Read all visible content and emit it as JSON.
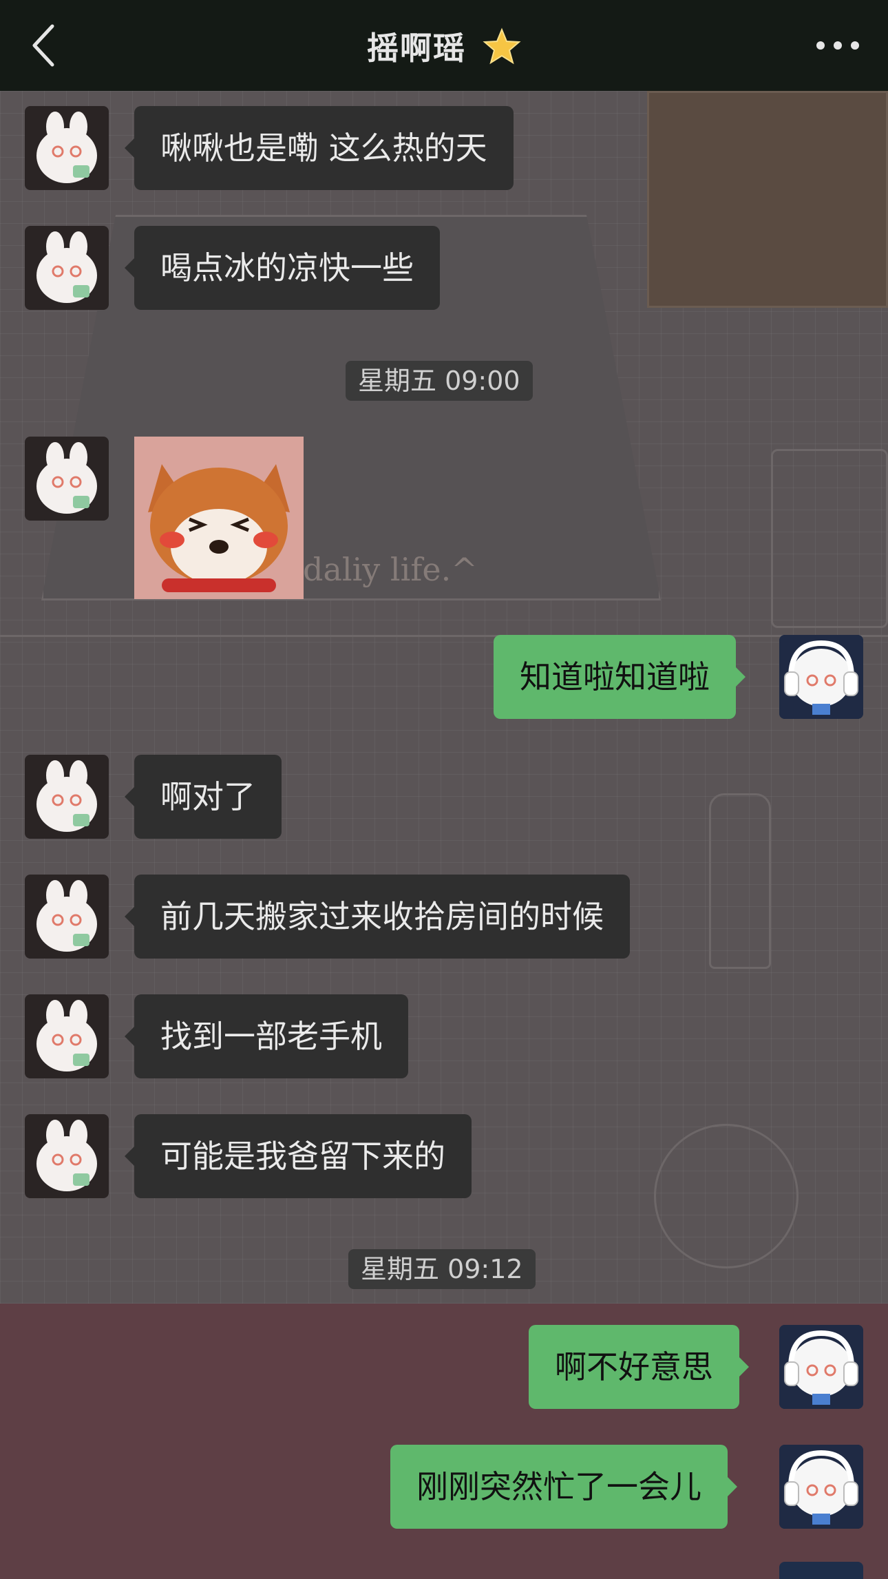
{
  "header": {
    "title": "摇啊瑶",
    "title_emoji": "star-emoji",
    "back_icon": "chevron-left-icon",
    "more_icon": "more-icon"
  },
  "background": {
    "decor_text": "daliy life.^"
  },
  "timestamps": [
    "星期五 09:00",
    "星期五 09:12"
  ],
  "messages": [
    {
      "from": "other",
      "type": "text",
      "text": "啾啾也是嘞 这么热的天"
    },
    {
      "from": "other",
      "type": "text",
      "text": "喝点冰的凉快一些"
    },
    {
      "from": "other",
      "type": "sticker",
      "sticker": "shiba-dog-sticker"
    },
    {
      "from": "me",
      "type": "text",
      "text": "知道啦知道啦"
    },
    {
      "from": "other",
      "type": "text",
      "text": "啊对了"
    },
    {
      "from": "other",
      "type": "text",
      "text": "前几天搬家过来收拾房间的时候"
    },
    {
      "from": "other",
      "type": "text",
      "text": "找到一部老手机"
    },
    {
      "from": "other",
      "type": "text",
      "text": "可能是我爸留下来的"
    },
    {
      "from": "me",
      "type": "text",
      "text": "啊不好意思"
    },
    {
      "from": "me",
      "type": "text",
      "text": "刚刚突然忙了一会儿"
    }
  ],
  "colors": {
    "header_bg": "#141a15",
    "received_bubble": "#2f2f2f",
    "sent_bubble": "#5fb86c",
    "timestamp_bg": "#3a3a3a"
  }
}
